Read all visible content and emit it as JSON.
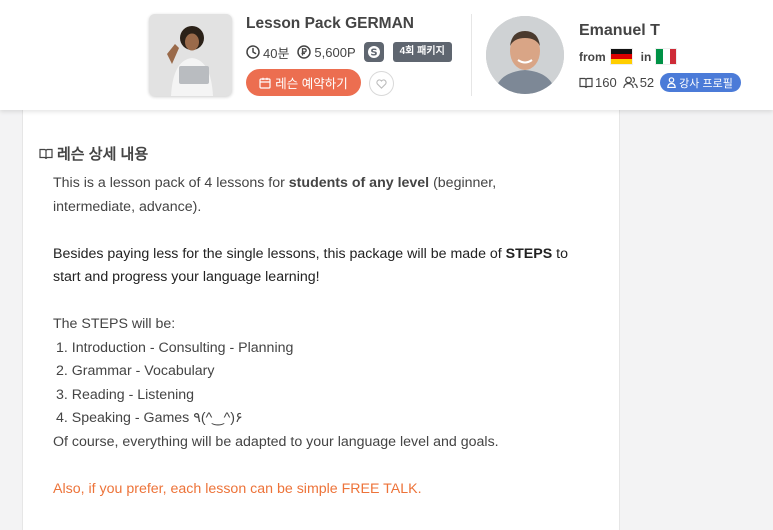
{
  "lesson": {
    "title": "Lesson Pack GERMAN",
    "duration": "40분",
    "price": "5,600P",
    "platform_icon": "skype-icon",
    "package_badge": "4회 패키지",
    "book_label": "레슨 예약하기"
  },
  "teacher": {
    "name": "Emanuel T",
    "from_label": "from",
    "in_label": "in",
    "from_flag": "germany",
    "in_flag": "italy",
    "lessons_count": "160",
    "students_count": "52",
    "profile_label": "강사 프로필"
  },
  "details": {
    "heading": "레슨 상세 내용",
    "p1_a": "This is a lesson pack of 4 lessons for ",
    "p1_bold": "students of any level",
    "p1_b": " (beginner,",
    "p1_c": "intermediate, advance).",
    "p2_a": "Besides paying less for the single lessons, this package will be made of ",
    "p2_bold": "STEPS",
    "p2_b": " to",
    "p2_c": "start and progress your language learning!",
    "steps_intro": "The STEPS will be:",
    "steps": [
      "1. Introduction - Consulting - Planning",
      "2. Grammar - Vocabulary",
      "3. Reading - Listening",
      "4. Speaking - Games ٩(^‿^)۶"
    ],
    "closing": "Of course, everything will be adapted to your language level and goals.",
    "free_talk": "Also, if you prefer, each lesson can be simple FREE TALK."
  },
  "colors": {
    "accent": "#ec6e50",
    "profile_blue": "#4b7bd8",
    "badge_gray": "#5f6670",
    "free_talk_orange": "#ed7339"
  }
}
